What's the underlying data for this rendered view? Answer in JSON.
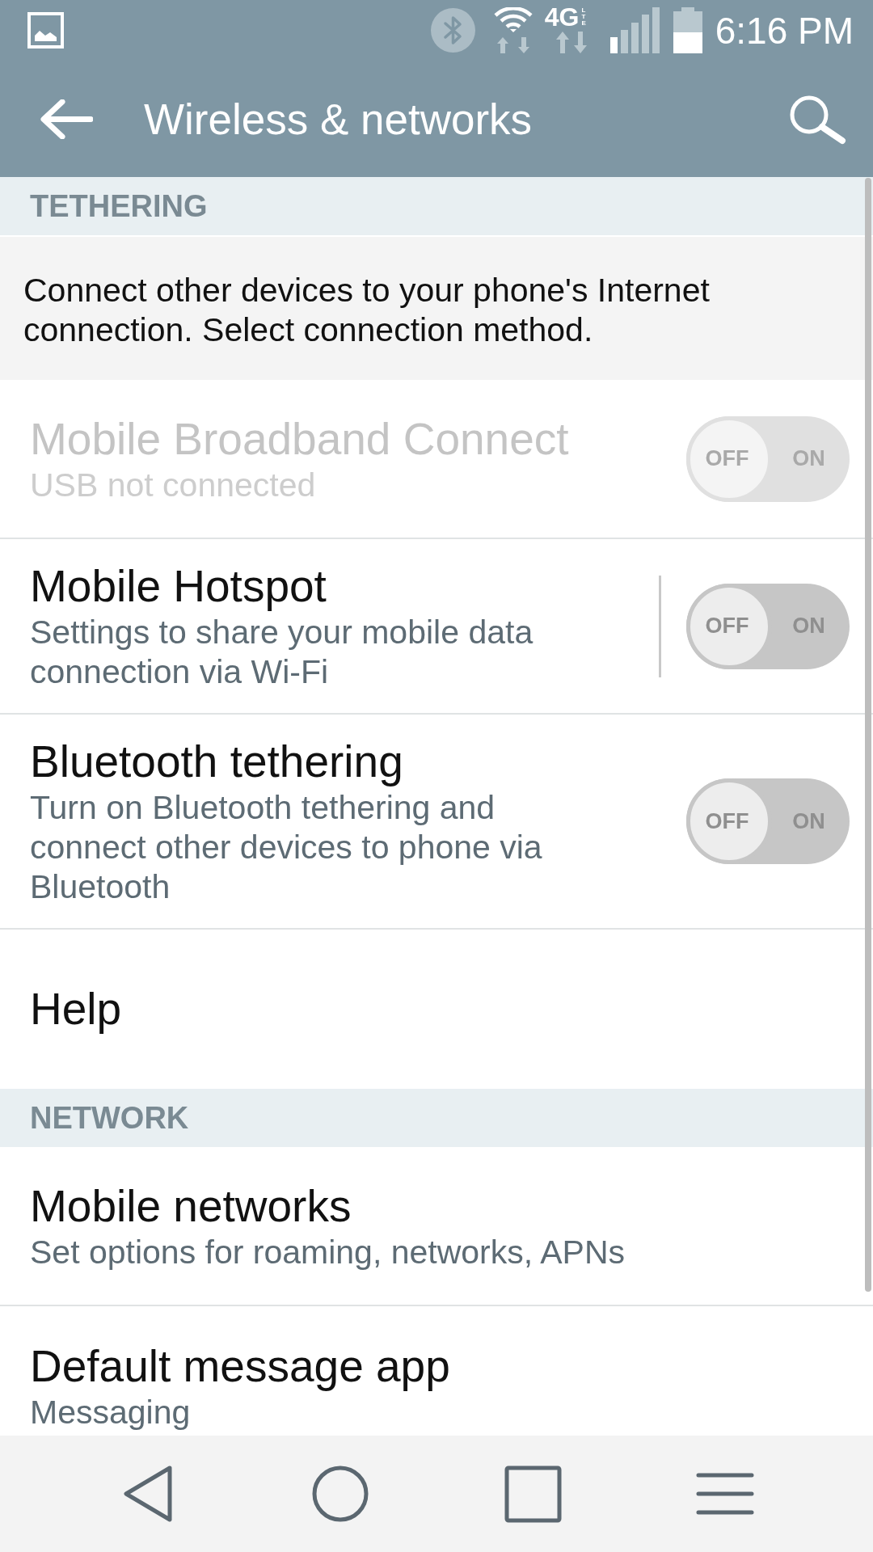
{
  "status_bar": {
    "time": "6:16 PM",
    "network_type": "4G",
    "network_subtype": "LTE"
  },
  "app_bar": {
    "title": "Wireless & networks"
  },
  "sections": [
    {
      "header": "TETHERING",
      "description": "Connect other devices to your phone's Internet connection. Select connection method.",
      "items": [
        {
          "kind": "toggle",
          "title": "Mobile Broadband Connect",
          "subtitle": "USB not connected",
          "disabled": true,
          "on": false,
          "split": false,
          "off_label": "OFF",
          "on_label": "ON"
        },
        {
          "kind": "toggle",
          "title": "Mobile Hotspot",
          "subtitle": "Settings to share your mobile data connection via Wi-Fi",
          "disabled": false,
          "on": false,
          "split": true,
          "off_label": "OFF",
          "on_label": "ON"
        },
        {
          "kind": "toggle",
          "title": "Bluetooth tethering",
          "subtitle": "Turn on Bluetooth tethering and connect other devices to phone via Bluetooth",
          "disabled": false,
          "on": false,
          "split": false,
          "off_label": "OFF",
          "on_label": "ON"
        },
        {
          "kind": "link",
          "title": "Help"
        }
      ]
    },
    {
      "header": "NETWORK",
      "items": [
        {
          "kind": "link",
          "title": "Mobile networks",
          "subtitle": "Set options for roaming, networks, APNs"
        },
        {
          "kind": "link",
          "title": "Default message app",
          "subtitle": "Messaging"
        }
      ]
    }
  ]
}
